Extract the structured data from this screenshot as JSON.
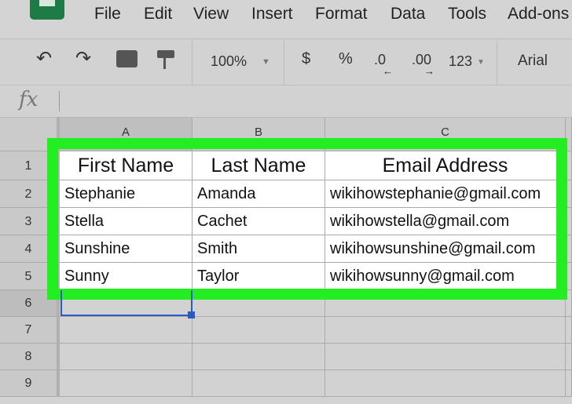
{
  "menu": [
    "File",
    "Edit",
    "View",
    "Insert",
    "Format",
    "Data",
    "Tools",
    "Add-ons"
  ],
  "toolbar": {
    "zoom": "100%",
    "currency": "$",
    "percent": "%",
    "dec_decrease": ".0",
    "dec_increase": ".00",
    "number_format": "123",
    "font": "Arial"
  },
  "formula_bar": {
    "label": "fx",
    "value": ""
  },
  "columns": [
    "A",
    "B",
    "C"
  ],
  "rows": [
    "1",
    "2",
    "3",
    "4",
    "5",
    "6",
    "7",
    "8",
    "9"
  ],
  "table": {
    "headers": [
      "First Name",
      "Last Name",
      "Email Address"
    ],
    "data": [
      [
        "Stephanie",
        "Amanda",
        "wikihowstephanie@gmail.com"
      ],
      [
        "Stella",
        "Cachet",
        "wikihowstella@gmail.com"
      ],
      [
        "Sunshine",
        "Smith",
        "wikihowsunshine@gmail.com"
      ],
      [
        "Sunny",
        "Taylor",
        "wikihowsunny@gmail.com"
      ]
    ]
  },
  "colors": {
    "highlight": "#22ee22",
    "selection": "#2c59c9",
    "logo": "#1e7b45"
  }
}
